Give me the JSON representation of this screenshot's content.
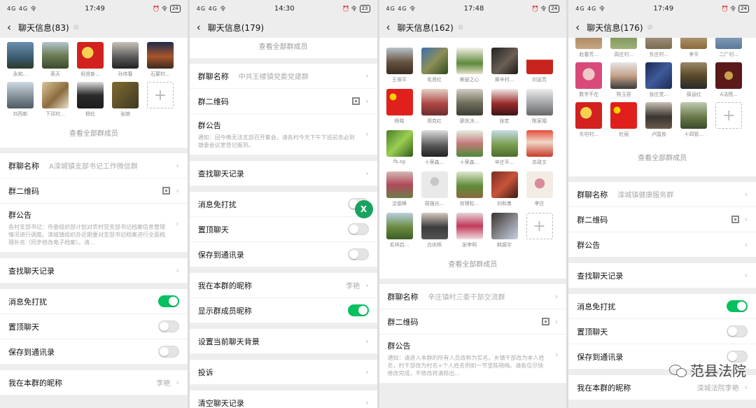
{
  "screens": [
    {
      "status": {
        "signal": "4G 4G 令",
        "time": "17:49",
        "right": "⏰ 令",
        "battery": "24"
      },
      "title": "聊天信息(83)",
      "members": [
        "永和...",
        "英天",
        "祝贤新...",
        "孙伟春",
        "石蒙村...",
        "刘西新",
        "下邓村...",
        "杨灶",
        "张婉"
      ],
      "view_all": "查看全部群成员",
      "group_name_label": "群聊名称",
      "group_name": "A滦城镇支部书记工作微信群",
      "qr_label": "群二维码",
      "notice_label": "群公告",
      "notice_text": "各村支部书记：市委组织部计划对农村党支部书记档案信息管理情况进行调度。滦城镇组织办近期要对支部书记档案进行全面梳理补充（同步修改电子档案）。请...",
      "history": "查找聊天记录",
      "mute": "消息免打扰",
      "pin": "置顶聊天",
      "save": "保存到通讯录",
      "nick_label": "我在本群的昵称",
      "nick": "李艳"
    },
    {
      "status": {
        "signal": "4G 4G 令",
        "time": "14:30",
        "right": "⏰ 令",
        "battery": "23"
      },
      "title": "聊天信息(179)",
      "view_all": "查看全部群成员",
      "group_name_label": "群聊名称",
      "group_name": "中共王楼镇党委党建群",
      "qr_label": "群二维码",
      "notice_label": "群公告",
      "notice_text": "通知：因今晚无法支部召开集会，请各村今天下午下班前务必到镇委会议室登记报到。",
      "history": "查找聊天记录",
      "mute": "消息免打扰",
      "pin": "置顶聊天",
      "save": "保存到通讯录",
      "nick_label": "我在本群的昵称",
      "nick": "李艳",
      "show_nick": "显示群成员昵称",
      "bg": "设置当前聊天背景",
      "complain": "投诉",
      "clear": "清空聊天记录",
      "fab": "X"
    },
    {
      "status": {
        "signal": "4G 4G 令",
        "time": "17:48",
        "right": "⏰ 令",
        "battery": "24"
      },
      "title": "聊天信息(162)",
      "members": [
        "王保平",
        "毛贤红",
        "美丽之心",
        "黄辛村...",
        "刘运芳",
        "杨晓",
        "郑克红",
        "廖庆决...",
        "张宏",
        "陈家福",
        "fb.sg",
        "十荣森...",
        "十荣森...",
        "辛庄平...",
        "苏政文",
        "沈俊峰",
        "周强光...",
        "肖理松...",
        "刘和勇",
        "李庄",
        "毛祥启...",
        "白庆辉",
        "张李明",
        "韩振宇"
      ],
      "view_all": "查看全部群成员",
      "group_name_label": "群聊名称",
      "group_name": "辛庄镇村三委干部交流群",
      "qr_label": "群二维码",
      "notice_label": "群公告",
      "notice_text": "通知：请进入本群的所有人员改称为实名。乡镇干部改为本人姓名，村干部改为村名+个人姓名例如一节里陈晓梅。请各位尽快修改完成，不修改将清除出..."
    },
    {
      "status": {
        "signal": "4G 4G 令",
        "time": "17:49",
        "right": "⏰ 令",
        "battery": "24"
      },
      "title": "聊天信息(176)",
      "members_top": [
        "赵春芳...",
        "周庄村...",
        "东庄村...",
        "李平",
        "二广村..."
      ],
      "members": [
        "数字不在",
        "陈玉容",
        "张庄党...",
        "薛运红",
        "A法院...",
        "东坦村...",
        "杜丽",
        "卢国良",
        "十四管..."
      ],
      "view_all": "查看全部群成员",
      "group_name_label": "群聊名称",
      "group_name": "滦城镇健康服务群",
      "qr_label": "群二维码",
      "notice_label": "群公告",
      "history": "查找聊天记录",
      "mute": "消息免打扰",
      "pin": "置顶聊天",
      "save": "保存到通讯录",
      "nick_label": "我在本群的昵称",
      "nick": "滦城法院李艳",
      "watermark": "范县法院"
    }
  ],
  "colors": {
    "accent": "#07c160",
    "bg": "#ededed"
  }
}
